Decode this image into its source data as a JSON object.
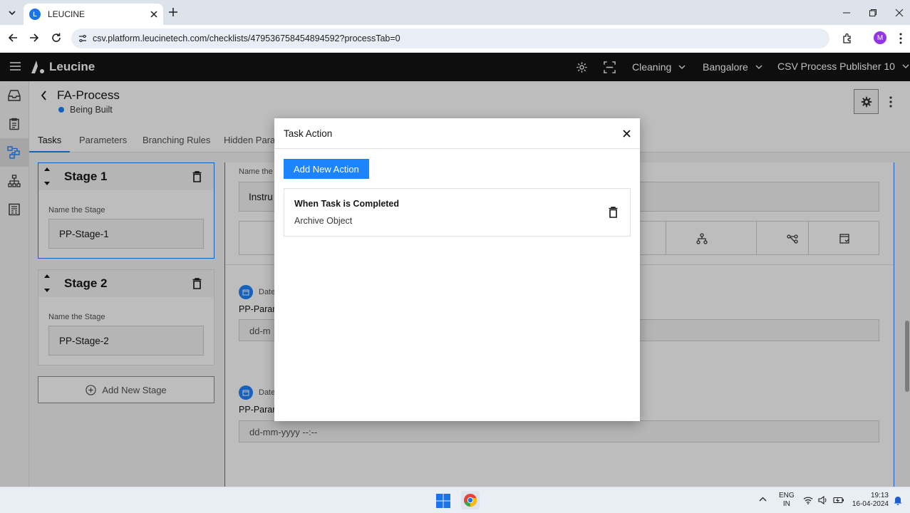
{
  "browser": {
    "tab_title": "LEUCINE",
    "tab_icon": "leucine-favicon",
    "url": "csv.platform.leucinetech.com/checklists/479536758454894592?processTab=0",
    "profile_initial": "M"
  },
  "app": {
    "logo_text": "Leucine",
    "facility_selector": "Cleaning",
    "site_selector": "Bangalore",
    "user_selector": "CSV Process Publisher 10"
  },
  "page": {
    "title": "FA-Process",
    "status": "Being Built",
    "status_color": "#1d84ff",
    "tabs": [
      "Tasks",
      "Parameters",
      "Branching Rules",
      "Hidden Param"
    ]
  },
  "stages": [
    {
      "title": "Stage 1",
      "field_label": "Name the Stage",
      "field_value": "PP-Stage-1"
    },
    {
      "title": "Stage 2",
      "field_label": "Name the Stage",
      "field_value": "PP-Stage-2"
    }
  ],
  "add_stage_label": "Add New Stage",
  "task_editor": {
    "name_label": "Name the t",
    "name_value": "Instru",
    "param1_type": "Date",
    "param1_label": "PP-Param",
    "param1_placeholder": "dd-m",
    "param2_type": "Date",
    "param2_label": "PP-Param",
    "param2_placeholder": "dd-mm-yyyy --:--"
  },
  "modal": {
    "title": "Task Action",
    "add_button": "Add New Action",
    "actions": [
      {
        "trigger": "When Task is Completed",
        "action": "Archive Object"
      }
    ]
  },
  "taskbar": {
    "lang_line1": "ENG",
    "lang_line2": "IN",
    "time": "19:13",
    "date": "16-04-2024"
  },
  "colors": {
    "primary": "#1d84ff",
    "header_bg": "#141414"
  }
}
